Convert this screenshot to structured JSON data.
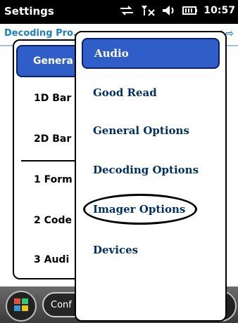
{
  "titlebar": {
    "title": "Settings",
    "time": "10:57"
  },
  "subheader": {
    "label": "Decoding Pro...",
    "nav": "◀ ⇨"
  },
  "left_panel": {
    "selected": "Genera",
    "items": [
      {
        "label": "1D Bar"
      },
      {
        "label": "2D Bar"
      },
      {
        "label": "1 Form"
      },
      {
        "label": "2 Code"
      },
      {
        "label": "3 Audi"
      }
    ]
  },
  "menu": {
    "items": [
      {
        "label": "Audio",
        "selected": true
      },
      {
        "label": "Good Read",
        "selected": false
      },
      {
        "label": "General Options",
        "selected": false
      },
      {
        "label": "Decoding Options",
        "selected": false
      },
      {
        "label": "Imager Options",
        "selected": false,
        "highlighted": true
      },
      {
        "label": "Devices",
        "selected": false
      }
    ]
  },
  "taskbar": {
    "conf_label": "Conf"
  },
  "colors": {
    "accent": "#2f5ec9",
    "title_bg": "#000000",
    "header_text": "#1d7fbf"
  }
}
